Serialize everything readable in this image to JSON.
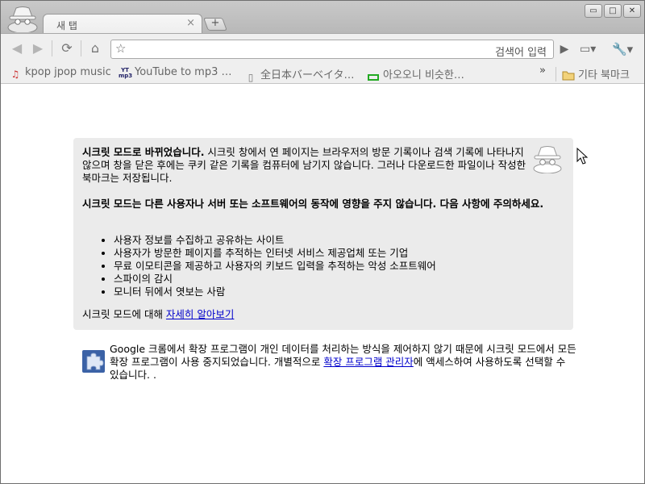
{
  "window": {
    "tab_title": "새 탭",
    "tab_close": "×",
    "new_tab": "+",
    "controls": {
      "minimize": "▭",
      "maximize": "□",
      "close": "✕"
    }
  },
  "toolbar": {
    "back": "◀",
    "forward": "▶",
    "reload": "⟳",
    "home": "⌂",
    "star": "☆",
    "omnibox_value": "",
    "omnibox_hint": "검색어 입력",
    "go": "▶",
    "page_menu": "▭▾",
    "wrench_menu": "🔧▾"
  },
  "bookmarks": {
    "items": [
      {
        "label": "kpop jpop music",
        "icon": "music-icon"
      },
      {
        "label": "YouTube to mp3 …",
        "icon": "yt-mp3-icon"
      },
      {
        "label": "全日本バーベイタ…",
        "icon": "page-icon"
      },
      {
        "label": "아오오니 비슷한…",
        "icon": "green-rect-icon"
      }
    ],
    "chevron": "»",
    "other_folder": "기타 북마크"
  },
  "incognito": {
    "lead_bold": "시크릿 모드로 바뀌었습니다.",
    "lead_text": " 시크릿 창에서 연 페이지는 브라우저의 방문 기록이나 검색 기록에 나타나지 않으며 창을 닫은 후에는 쿠키 같은 기록을 컴퓨터에 남기지 않습니다. 그러나 다운로드한 파일이나 작성한 북마크는 저장됩니다.",
    "warning": "시크릿 모드는 다른 사용자나 서버 또는 소프트웨어의 동작에 영향을 주지 않습니다. 다음 사항에 주의하세요.",
    "list": [
      "사용자 정보를 수집하고 공유하는 사이트",
      "사용자가 방문한 페이지를 추적하는 인터넷 서비스 제공업체 또는 기업",
      "무료 이모티콘을 제공하고 사용자의 키보드 입력을 추적하는 악성 소프트웨어",
      "스파이의 감시",
      "모니터 뒤에서 엿보는 사람"
    ],
    "learn_prefix": "시크릿 모드에 대해 ",
    "learn_link": "자세히 알아보기"
  },
  "extensions": {
    "text_before": "Google 크롬에서 확장 프로그램이 개인 데이터를 처리하는 방식을 제어하지 않기 때문에 시크릿 모드에서 모든 확장 프로그램이 사용 중지되었습니다. 개별적으로 ",
    "link": "확장 프로그램 관리자",
    "text_after": "에 액세스하여 사용하도록 선택할 수 있습니다. ."
  }
}
